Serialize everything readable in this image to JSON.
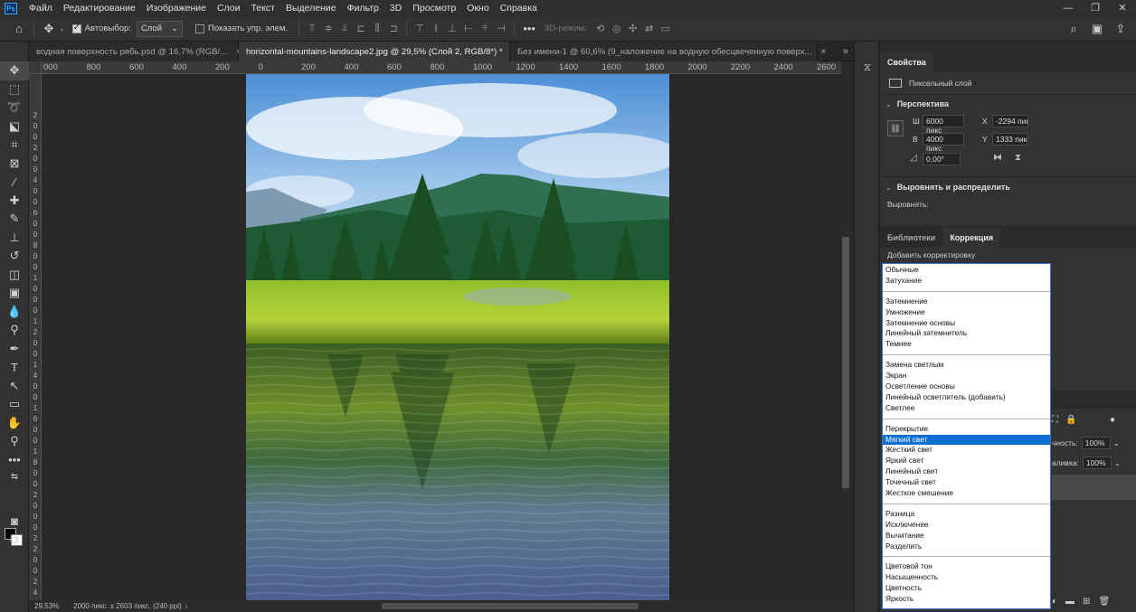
{
  "menubar": {
    "logo": "Ps",
    "items": [
      "Файл",
      "Редактирование",
      "Изображение",
      "Слои",
      "Текст",
      "Выделение",
      "Фильтр",
      "3D",
      "Просмотр",
      "Окно",
      "Справка"
    ]
  },
  "options": {
    "autoselect_label": "Автовыбор:",
    "autoselect_value": "Слой",
    "show_transform_label": "Показать упр. элем.",
    "mode_3d_label": "3D-режим:"
  },
  "tabs": [
    {
      "label": "водная поверхность рябь.psd @ 16,7% (RGB/..."
    },
    {
      "label": "horizontal-mountains-landscape2.jpg @ 29,5% (Слой 2, RGB/8*) *"
    },
    {
      "label": "Без имени-1 @ 60,6% (9_наложение на водную обесцвеченную поверх..."
    }
  ],
  "ruler": {
    "h_ticks": [
      "000",
      "800",
      "600",
      "400",
      "200",
      "0",
      "200",
      "400",
      "600",
      "800",
      "1000",
      "1200",
      "1400",
      "1600",
      "1800",
      "2000",
      "2200",
      "2400",
      "2600"
    ],
    "v_ticks": [
      "2",
      "0",
      "0",
      "2",
      "0",
      "0",
      "4",
      "0",
      "0",
      "6",
      "0",
      "0",
      "8",
      "0",
      "0",
      "1",
      "0",
      "0",
      "0",
      "1",
      "2",
      "0",
      "0",
      "1",
      "4",
      "0",
      "0",
      "1",
      "6",
      "0",
      "0",
      "1",
      "8",
      "0",
      "0",
      "2",
      "0",
      "0",
      "0",
      "2",
      "2",
      "0",
      "0",
      "2",
      "4",
      "0",
      "0"
    ]
  },
  "status": {
    "zoom": "29,53%",
    "doc_info": "2000 пикс. x 2603 пикс. (240 ppi)"
  },
  "properties": {
    "tab_label": "Свойства",
    "layer_type": "Пиксельный слой",
    "perspective_title": "Перспектива",
    "w_label": "Ш",
    "w_value": "6000 пикс",
    "h_label": "В",
    "h_value": "4000 пикс",
    "x_label": "X",
    "x_value": "-2294 пикс",
    "y_label": "Y",
    "y_value": "1333 пикс",
    "angle_value": "0,00°",
    "align_title": "Выровнять и распределить",
    "align_label": "Выровнять:"
  },
  "lower_tabs": {
    "libraries": "Библиотеки",
    "correction": "Коррекция",
    "add_correction": "Добавить корректировку"
  },
  "layers_partial": {
    "opacity_label": "чность:",
    "opacity_value": "100%",
    "fill_label": "аливка:",
    "fill_value": "100%"
  },
  "blend_modes": {
    "selected": "Мягкий свет",
    "groups": [
      [
        "Обычные",
        "Затухание"
      ],
      [
        "Затемнение",
        "Умножение",
        "Затемнение основы",
        "Линейный затемнитель",
        "Темнее"
      ],
      [
        "Замена светлым",
        "Экран",
        "Осветление основы",
        "Линейный осветлитель (добавить)",
        "Светлее"
      ],
      [
        "Перекрытие",
        "Мягкий свет",
        "Жесткий свет",
        "Яркий свет",
        "Линейный свет",
        "Точечный свет",
        "Жесткое смешение"
      ],
      [
        "Разница",
        "Исключение",
        "Вычитание",
        "Разделить"
      ],
      [
        "Цветовой тон",
        "Насыщенность",
        "Цветность",
        "Яркость"
      ]
    ]
  }
}
